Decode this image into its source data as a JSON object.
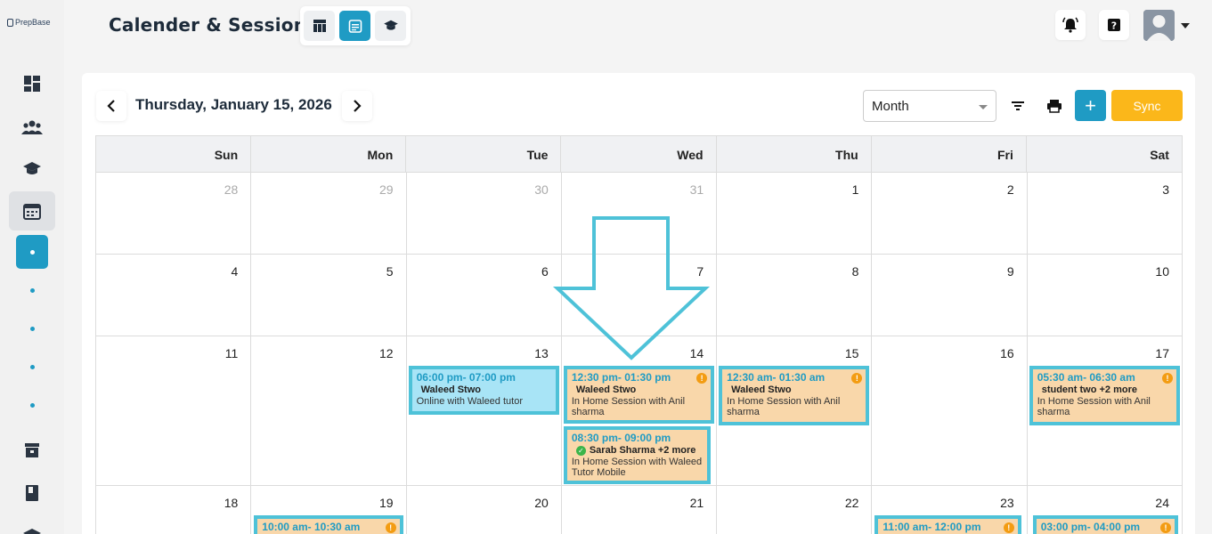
{
  "app": {
    "logo_text": "PrepBase",
    "page_title": "Calender & Sessions"
  },
  "header": {
    "user_avatar": "user-avatar"
  },
  "toolbar": {
    "date_label": "Thursday, January 15, 2026",
    "view_select_value": "Month",
    "sync_label": "Sync",
    "add_label": "+"
  },
  "calendar": {
    "weekdays": [
      "Sun",
      "Mon",
      "Tue",
      "Wed",
      "Thu",
      "Fri",
      "Sat"
    ],
    "weeks": [
      [
        "28",
        "29",
        "30",
        "31",
        "1",
        "2",
        "3"
      ],
      [
        "4",
        "5",
        "6",
        "7",
        "8",
        "9",
        "10"
      ],
      [
        "11",
        "12",
        "13",
        "14",
        "15",
        "16",
        "17"
      ],
      [
        "18",
        "19",
        "20",
        "21",
        "22",
        "23",
        "24"
      ]
    ],
    "events": {
      "tue13": {
        "time": "06:00 pm- 07:00 pm",
        "who": "Waleed Stwo",
        "desc": "Online with Waleed tutor"
      },
      "wed14a": {
        "time": "12:30 pm- 01:30 pm",
        "who": "Waleed Stwo",
        "desc": "In Home Session with Anil sharma"
      },
      "wed14b": {
        "time": "08:30 pm- 09:00 pm",
        "who": "Sarab Sharma +2 more",
        "desc": "In Home Session with Waleed Tutor Mobile"
      },
      "thu15": {
        "time": "12:30 am- 01:30 am",
        "who": "Waleed Stwo",
        "desc": "In Home Session with Anil sharma"
      },
      "sat17": {
        "time": "05:30 am- 06:30 am",
        "who": "student two +2 more",
        "desc": "In Home Session with Anil sharma"
      },
      "mon19": {
        "time": "10:00 am- 10:30 am"
      },
      "fri23": {
        "time": "11:00 am- 12:00 pm"
      },
      "sat24": {
        "time": "03:00 pm- 04:00 pm"
      }
    }
  },
  "colors": {
    "accent": "#1f9bc4",
    "sync": "#fbb71a",
    "event_bg": "#f9d7aa",
    "event_online_bg": "#a8e4f6",
    "highlight": "#4ec2d8"
  }
}
